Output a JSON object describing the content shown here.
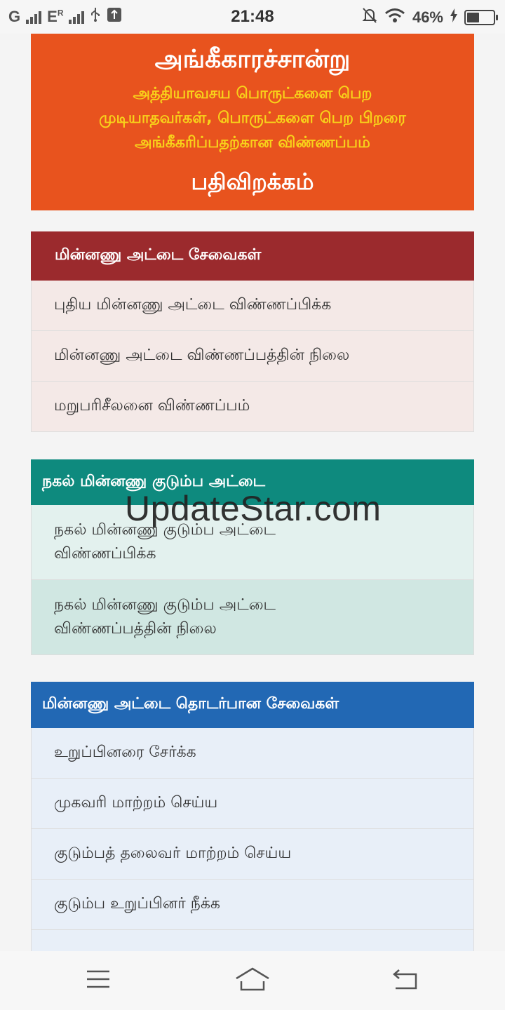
{
  "status_bar": {
    "carrier1": "G",
    "carrier2": "E",
    "carrier2_sup": "R",
    "time": "21:48",
    "battery": "46%",
    "battery_level": 0.46
  },
  "banner": {
    "title": "அங்கீகாரச்சான்று",
    "subtitle_line1": "அத்தியாவசய பொருட்களை பெற",
    "subtitle_line2": "முடியாதவர்கள், பொருட்களை பெற பிறரை",
    "subtitle_line3": "அங்கீகரிப்பதற்கான விண்ணப்பம்",
    "download": "பதிவிறக்கம்"
  },
  "smart_card_services": {
    "header": "மின்னணு அட்டை சேவைகள்",
    "items": [
      {
        "label": "புதிய மின்னணு அட்டை விண்ணப்பிக்க"
      },
      {
        "label": "மின்னணு அட்டை விண்ணப்பத்தின் நிலை"
      },
      {
        "label": "மறுபரிசீலனை விண்ணப்பம்"
      }
    ]
  },
  "duplicate_card": {
    "header": "நகல் மின்னணு குடும்ப அட்டை",
    "items": [
      {
        "line1": "நகல் மின்னணு குடும்ப அட்டை",
        "line2": "விண்ணப்பிக்க"
      },
      {
        "line1": "நகல் மின்னணு குடும்ப அட்டை",
        "line2": "விண்ணப்பத்தின் நிலை"
      }
    ]
  },
  "related_services": {
    "header": "மின்னணு அட்டை தொடர்பான சேவைகள்",
    "items": [
      {
        "label": "உறுப்பினரை சேர்க்க"
      },
      {
        "label": "முகவரி மாற்றம் செய்ய"
      },
      {
        "label": "குடும்பத் தலைவர் மாற்றம் செய்ய"
      },
      {
        "label": "குடும்ப உறுப்பினர் நீக்க"
      }
    ]
  },
  "watermark": "UpdateStar.com",
  "colors": {
    "banner": "#e8531e",
    "section1": "#9b2a2d",
    "section2": "#0e8a7e",
    "section3": "#2268b4"
  }
}
